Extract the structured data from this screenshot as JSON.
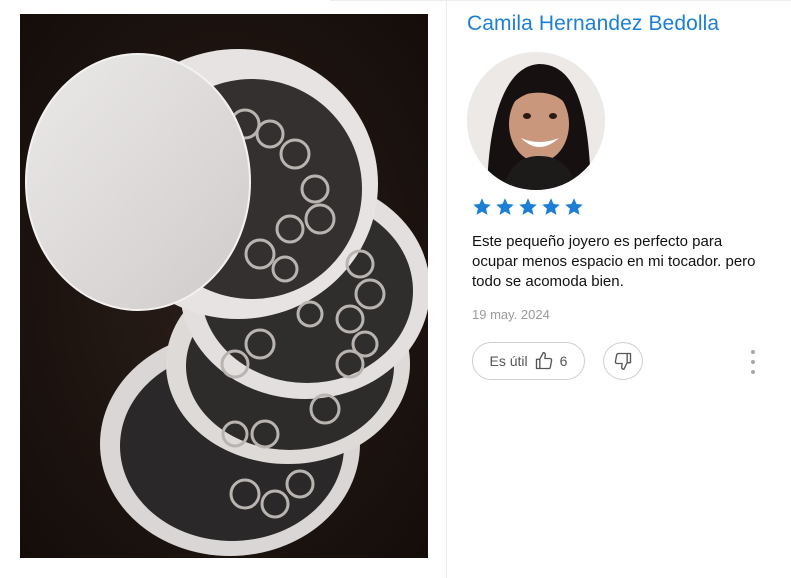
{
  "review": {
    "reviewer_name": "Camila Hernandez Bedolla",
    "rating": 5,
    "rating_max": 5,
    "text": "Este pequeño joyero es perfecto para ocupar menos espacio en mi tocador. pero todo se acomoda bien.",
    "date": "19 may. 2024",
    "helpful_label": "Es útil",
    "helpful_count": "6"
  },
  "icons": {
    "star": "star-icon",
    "helpful": "thumbs-up-icon",
    "not_helpful": "thumbs-down-icon",
    "more": "more-vertical-icon"
  },
  "colors": {
    "name": "#1c7fd6",
    "star": "#1c7fd6",
    "date": "#9a9a9a",
    "button_border": "#cfcfcf"
  }
}
